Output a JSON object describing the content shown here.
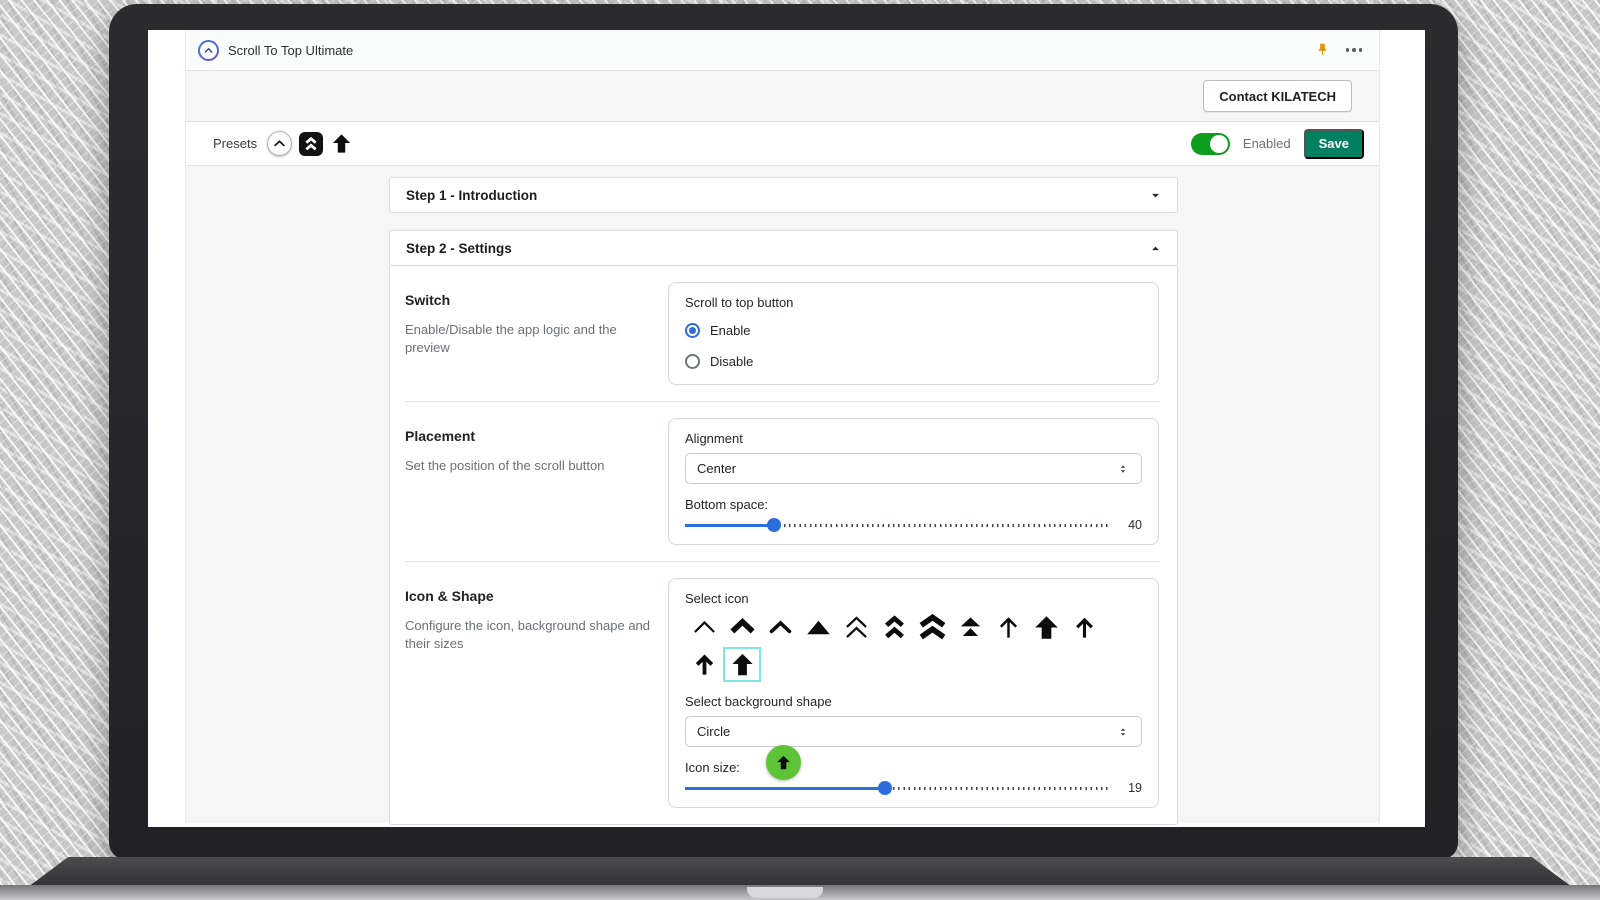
{
  "header": {
    "app_title": "Scroll To Top Ultimate",
    "contact_button_label": "Contact KILATECH"
  },
  "presets_bar": {
    "label": "Presets",
    "presets": [
      {
        "name": "circle-chevron-up"
      },
      {
        "name": "square-double-chevron-up"
      },
      {
        "name": "solid-arrow-up"
      }
    ],
    "toggle": {
      "state": "on",
      "label": "Enabled"
    },
    "save_button_label": "Save"
  },
  "steps": [
    {
      "label": "Step 1 - Introduction",
      "expanded": false
    },
    {
      "label": "Step 2 - Settings",
      "expanded": true
    }
  ],
  "settings": {
    "switch": {
      "title": "Switch",
      "description": "Enable/Disable the app logic and the preview",
      "group_label": "Scroll to top button",
      "options": [
        {
          "label": "Enable",
          "selected": true
        },
        {
          "label": "Disable",
          "selected": false
        }
      ]
    },
    "placement": {
      "title": "Placement",
      "description": "Set the position of the scroll button",
      "alignment": {
        "label": "Alignment",
        "value": "Center"
      },
      "bottom_space": {
        "label": "Bottom space:",
        "value": "40",
        "percent": 21
      }
    },
    "icon_shape": {
      "title": "Icon & Shape",
      "description": "Configure the icon, background shape and their sizes",
      "select_icon_label": "Select icon",
      "icons": [
        {
          "name": "chevron-up-thin"
        },
        {
          "name": "chevron-up-bold"
        },
        {
          "name": "chevron-up-medium"
        },
        {
          "name": "triangle-up-solid"
        },
        {
          "name": "double-chevron-up-thin"
        },
        {
          "name": "double-chevron-up-bold"
        },
        {
          "name": "double-chevron-up-wide"
        },
        {
          "name": "double-triangle-up"
        },
        {
          "name": "arrow-up-thin"
        },
        {
          "name": "arrow-up-block"
        },
        {
          "name": "arrow-up-medium"
        },
        {
          "name": "arrow-up-bold"
        },
        {
          "name": "arrow-up-solid",
          "selected": true
        }
      ],
      "background_shape": {
        "label": "Select background shape",
        "value": "Circle"
      },
      "icon_size": {
        "label": "Icon size:",
        "value": "19",
        "percent": 47
      },
      "preview_button": {
        "shape": "circle",
        "color": "#5ec336",
        "icon": "arrow-up-solid"
      }
    }
  },
  "colors": {
    "accent_blue": "#2c6ede",
    "toggle_green": "#0f9d1f",
    "save_green": "#008060",
    "pin_amber": "#e0930c",
    "selected_icon_border": "#7ce8e1",
    "preview_green": "#5ec336"
  }
}
